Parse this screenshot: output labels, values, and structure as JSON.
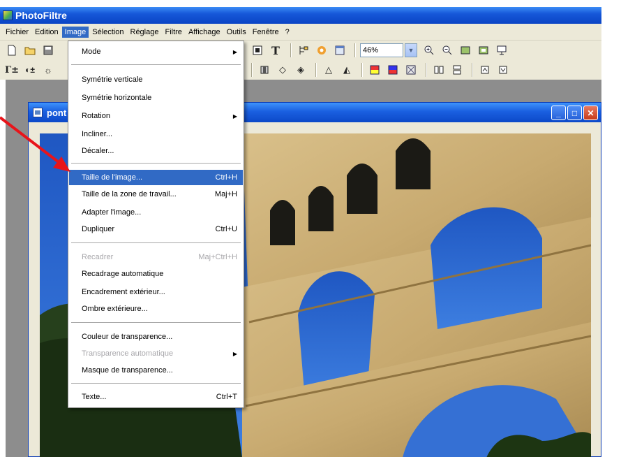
{
  "app": {
    "title": "PhotoFiltre"
  },
  "menubar": {
    "items": [
      "Fichier",
      "Edition",
      "Image",
      "Sélection",
      "Réglage",
      "Filtre",
      "Affichage",
      "Outils",
      "Fenêtre",
      "?"
    ],
    "active": "Image"
  },
  "toolbar": {
    "zoom_value": "46%",
    "icons": [
      "new-icon",
      "open-icon",
      "save-icon",
      "text-icon",
      "zoom-in-icon",
      "zoom-out-icon",
      "fit-icon",
      "fullscreen-icon"
    ]
  },
  "document": {
    "title": "pont",
    "buttons": [
      "minimize",
      "maximize",
      "close"
    ]
  },
  "image_menu": {
    "items": [
      {
        "label": "Mode",
        "shortcut": "",
        "submenu": true,
        "disabled": false,
        "highlighted": false
      },
      {
        "label": "Symétrie verticale",
        "shortcut": "",
        "submenu": false,
        "disabled": false,
        "highlighted": false
      },
      {
        "label": "Symétrie horizontale",
        "shortcut": "",
        "submenu": false,
        "disabled": false,
        "highlighted": false
      },
      {
        "label": "Rotation",
        "shortcut": "",
        "submenu": true,
        "disabled": false,
        "highlighted": false
      },
      {
        "label": "Incliner...",
        "shortcut": "",
        "submenu": false,
        "disabled": false,
        "highlighted": false
      },
      {
        "label": "Décaler...",
        "shortcut": "",
        "submenu": false,
        "disabled": false,
        "highlighted": false
      },
      {
        "label": "Taille de l'image...",
        "shortcut": "Ctrl+H",
        "submenu": false,
        "disabled": false,
        "highlighted": true
      },
      {
        "label": "Taille de la zone de travail...",
        "shortcut": "Maj+H",
        "submenu": false,
        "disabled": false,
        "highlighted": false
      },
      {
        "label": "Adapter l'image...",
        "shortcut": "",
        "submenu": false,
        "disabled": false,
        "highlighted": false
      },
      {
        "label": "Dupliquer",
        "shortcut": "Ctrl+U",
        "submenu": false,
        "disabled": false,
        "highlighted": false
      },
      {
        "label": "Recadrer",
        "shortcut": "Maj+Ctrl+H",
        "submenu": false,
        "disabled": true,
        "highlighted": false
      },
      {
        "label": "Recadrage automatique",
        "shortcut": "",
        "submenu": false,
        "disabled": false,
        "highlighted": false
      },
      {
        "label": "Encadrement extérieur...",
        "shortcut": "",
        "submenu": false,
        "disabled": false,
        "highlighted": false
      },
      {
        "label": "Ombre extérieure...",
        "shortcut": "",
        "submenu": false,
        "disabled": false,
        "highlighted": false
      },
      {
        "label": "Couleur de transparence...",
        "shortcut": "",
        "submenu": false,
        "disabled": false,
        "highlighted": false
      },
      {
        "label": "Transparence automatique",
        "shortcut": "",
        "submenu": true,
        "disabled": true,
        "highlighted": false
      },
      {
        "label": "Masque de transparence...",
        "shortcut": "",
        "submenu": false,
        "disabled": false,
        "highlighted": false
      },
      {
        "label": "Texte...",
        "shortcut": "Ctrl+T",
        "submenu": false,
        "disabled": false,
        "highlighted": false
      }
    ]
  },
  "colors": {
    "titlebar": "#0a44c4",
    "menu_highlight": "#316ac5",
    "toolbar_bg": "#ece9d8",
    "annotation_arrow": "#e8141a",
    "sky": "#2a63c8"
  }
}
